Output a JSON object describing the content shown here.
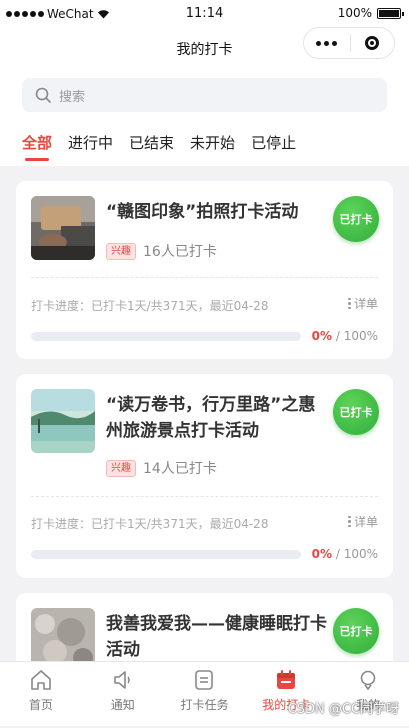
{
  "status_bar": {
    "carrier": "WeChat",
    "time": "11:14",
    "battery": "100%"
  },
  "nav": {
    "title": "我的打卡"
  },
  "search": {
    "placeholder": "搜索"
  },
  "tabs": [
    {
      "label": "全部",
      "active": true
    },
    {
      "label": "进行中",
      "active": false
    },
    {
      "label": "已结束",
      "active": false
    },
    {
      "label": "未开始",
      "active": false
    },
    {
      "label": "已停止",
      "active": false
    }
  ],
  "cards": [
    {
      "title": "“赣图印象”拍照打卡活动",
      "tag": "兴趣",
      "count": "16人已打卡",
      "button": "已打卡",
      "progress_text": "打卡进度：已打卡1天/共371天，最近04-28",
      "detail": "详单",
      "progress_current": "0%",
      "progress_sep": " / ",
      "progress_total": "100%",
      "progress_value": 0
    },
    {
      "title": "“读万卷书，行万里路”之惠州旅游景点打卡活动",
      "tag": "兴趣",
      "count": "14人已打卡",
      "button": "已打卡",
      "progress_text": "打卡进度：已打卡1天/共371天，最近04-28",
      "detail": "详单",
      "progress_current": "0%",
      "progress_sep": " / ",
      "progress_total": "100%",
      "progress_value": 0
    },
    {
      "title": "我善我爱我——健康睡眠打卡活动",
      "button": "已打卡"
    }
  ],
  "tabbar": [
    {
      "label": "首页",
      "icon": "home-icon",
      "active": false
    },
    {
      "label": "通知",
      "icon": "speaker-icon",
      "active": false
    },
    {
      "label": "打卡任务",
      "icon": "task-icon",
      "active": false
    },
    {
      "label": "我的打卡",
      "icon": "calendar-icon",
      "active": true
    },
    {
      "label": "我的",
      "icon": "person-icon",
      "active": false
    }
  ],
  "colors": {
    "accent": "#e8473f",
    "checkin_green": "#3bb84a"
  },
  "watermark": "CSDN @CC同学呀"
}
